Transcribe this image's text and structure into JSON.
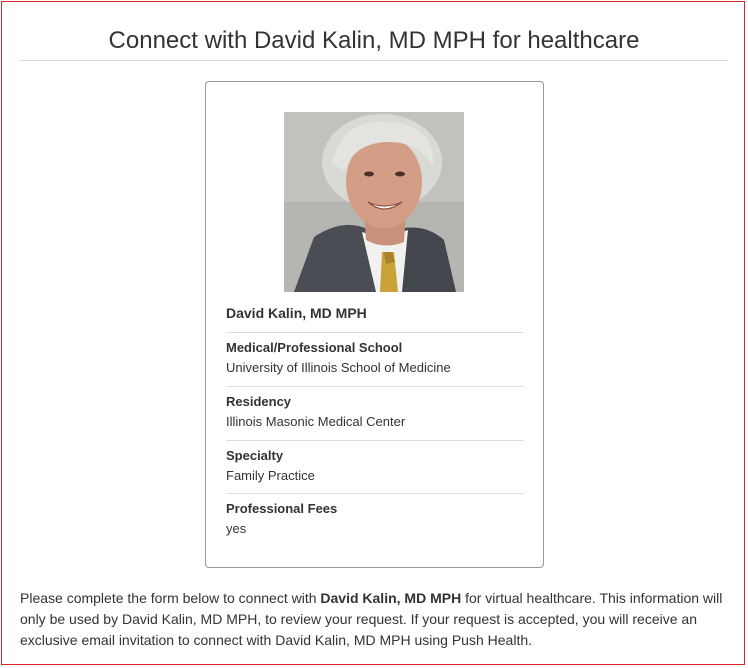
{
  "page": {
    "title": "Connect with David Kalin, MD MPH for healthcare",
    "border_color": "#d9262a"
  },
  "card": {
    "photo_alt": "David Kalin, MD MPH",
    "name": "David Kalin, MD MPH",
    "sections": [
      {
        "label": "Medical/Professional School",
        "value": "University of Illinois School of Medicine"
      },
      {
        "label": "Residency",
        "value": "Illinois Masonic Medical Center"
      },
      {
        "label": "Specialty",
        "value": "Family Practice"
      },
      {
        "label": "Professional Fees",
        "value": "yes"
      }
    ]
  },
  "intro": {
    "part1": "Please complete the form below to connect with ",
    "doctor_bold": "David Kalin, MD MPH",
    "part2": " for virtual healthcare. This information will only be used by David Kalin, MD MPH, to review your request. If your request is accepted, you will receive an exclusive email invitation to connect with David Kalin, MD MPH using Push Health."
  }
}
